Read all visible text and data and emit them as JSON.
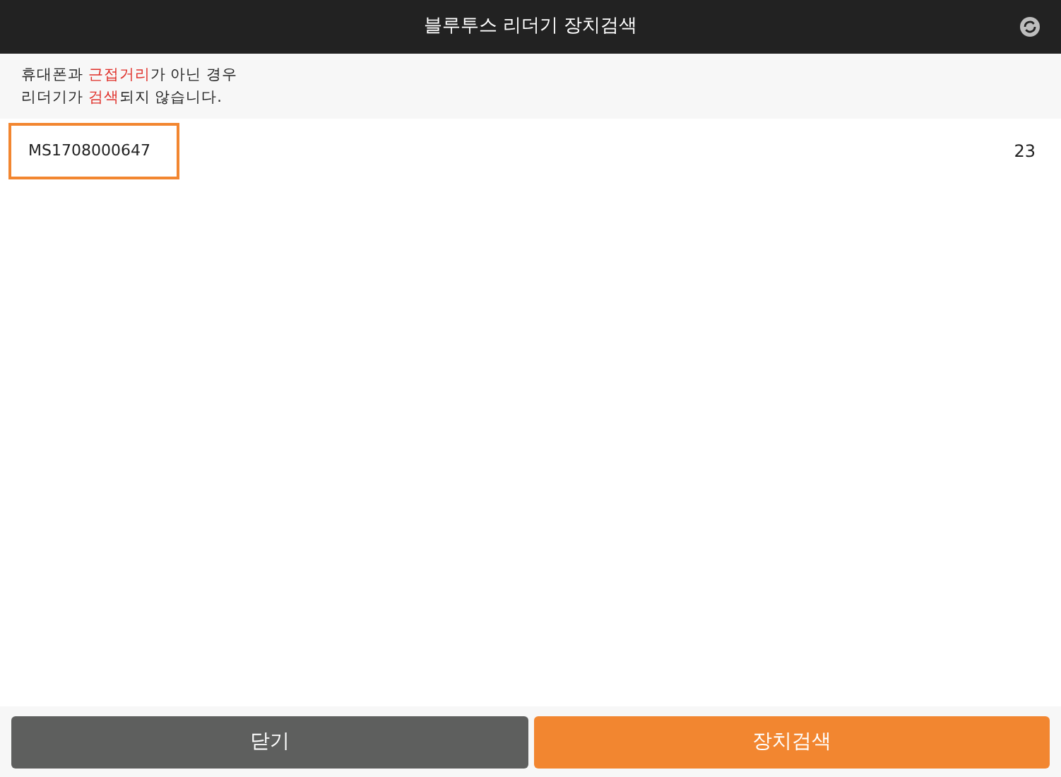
{
  "window": {
    "title": "블루투스 리더기 장치검색"
  },
  "notice": {
    "lines": [
      [
        {
          "text": "휴대폰과 ",
          "highlight": false
        },
        {
          "text": "근접거리",
          "highlight": true
        },
        {
          "text": "가 아닌 경우",
          "highlight": false
        }
      ],
      [
        {
          "text": "리더기가 ",
          "highlight": false
        },
        {
          "text": "검색",
          "highlight": true
        },
        {
          "text": "되지 않습니다.",
          "highlight": false
        }
      ]
    ]
  },
  "devices": [
    {
      "name": "MS1708000647",
      "value": "23",
      "selected": true
    }
  ],
  "buttons": [
    {
      "label": "닫기",
      "kind": "secondary"
    },
    {
      "label": "장치검색",
      "kind": "primary"
    }
  ]
}
